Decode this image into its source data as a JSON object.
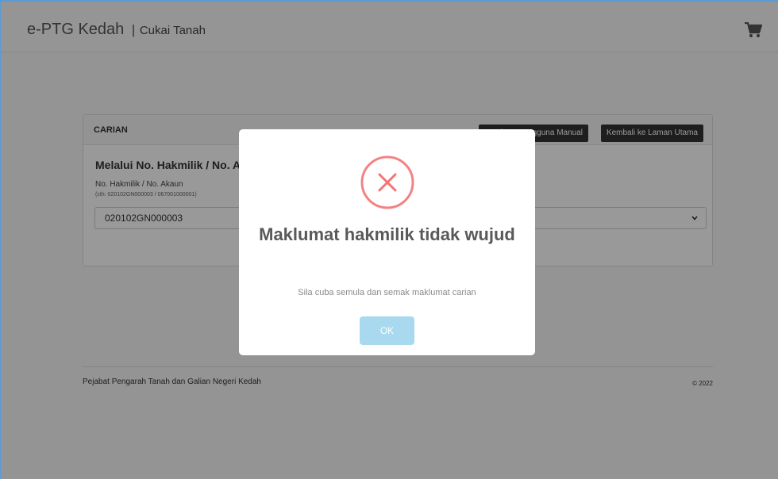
{
  "header": {
    "brand": "e-PTG Kedah",
    "separator": "|",
    "subtitle": "Cukai Tanah",
    "cart_icon": "cart-icon"
  },
  "panel": {
    "title": "CARIAN",
    "manual_button": "Panduan Pengguna Manual",
    "home_button": "Kembali ke Laman Utama",
    "section_title": "Melalui No. Hakmilik / No. Akaun",
    "field_label": "No. Hakmilik / No. Akaun",
    "field_hint": "(cth: 020102GN000003 / 067001000001)",
    "field_value": "020102GN000003",
    "select_value": ""
  },
  "footer": {
    "left": "Pejabat Pengarah Tanah dan Galian Negeri Kedah",
    "right": "© 2022"
  },
  "modal": {
    "icon": "error-x-icon",
    "icon_color": "#f27474",
    "title": "Maklumat hakmilik tidak wujud",
    "text": "Sila cuba semula dan semak maklumat carian",
    "ok_label": "OK",
    "ok_color": "#a8d9ee"
  }
}
